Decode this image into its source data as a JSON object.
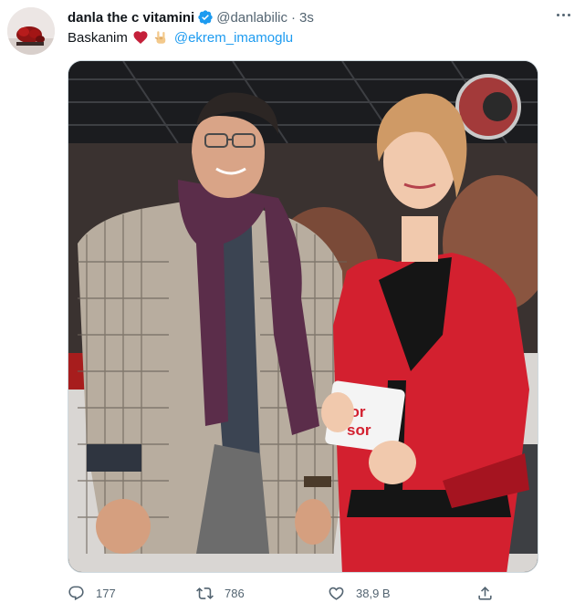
{
  "tweet": {
    "display_name": "danla the c vitamini",
    "verified_icon": "verified-badge-icon",
    "handle": "@danlabilic",
    "separator": "·",
    "time": "3s",
    "text": "Baskanim",
    "emojis": [
      "red-heart-icon",
      "sign-of-horns-hand-icon"
    ],
    "mention": "@ekrem_imamoglu",
    "media_logo_text": [
      "zor",
      "sor"
    ],
    "metrics": {
      "replies": "177",
      "retweets": "786",
      "likes": "38,9 B"
    }
  },
  "colors": {
    "accent": "#1d9bf0",
    "muted": "#536471",
    "like_red": "#e0245e"
  }
}
